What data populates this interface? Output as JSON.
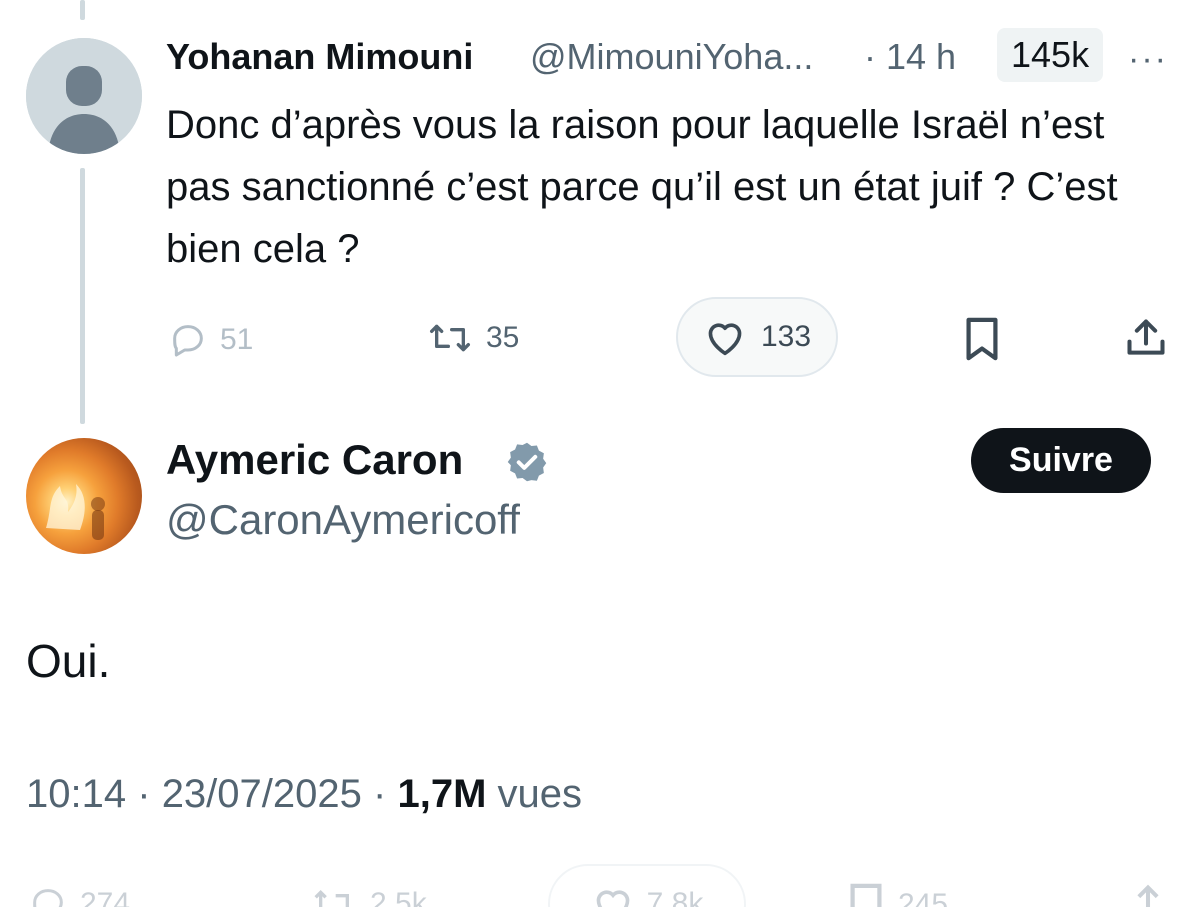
{
  "tweet": {
    "author_name": "Yohanan Mimouni",
    "handle": "@MimouniYoha...",
    "dot_time": "· 14 h",
    "views_badge": "145k",
    "more": "···",
    "text": "Donc d’après vous la raison pour laquelle Israël n’est pas sanctionné c’est parce qu’il est un état juif ? C’est bien cela ?",
    "actions": {
      "replies": "51",
      "reposts": "35",
      "likes": "133"
    }
  },
  "reply": {
    "author_name": "Aymeric Caron",
    "handle": "@CaronAymericoff",
    "follow_label": "Suivre",
    "text": "Oui.",
    "time": "10:14",
    "date": "23/07/2025",
    "views_count": "1,7M",
    "views_label": "vues",
    "actions": {
      "replies": "274",
      "reposts": "2,5k",
      "likes": "7,8k",
      "bookmarks": "245"
    }
  },
  "colors": {
    "accent": "#0f1419",
    "muted": "#536471",
    "thread_line": "#cfd9de",
    "verified": "#829aab"
  }
}
